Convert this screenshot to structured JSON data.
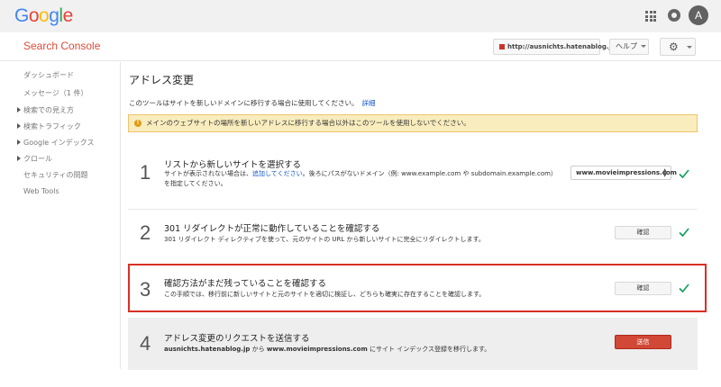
{
  "header": {
    "logo": "Google",
    "avatar_letter": "A"
  },
  "subbar": {
    "product": "Search Console",
    "site": "http://ausnichts.hatenablog.jp/",
    "help": "ヘルプ"
  },
  "sidebar": {
    "items": [
      {
        "label": "ダッシュボード",
        "expandable": false
      },
      {
        "label": "メッセージ（1 件）",
        "expandable": false
      },
      {
        "label": "検索での見え方",
        "expandable": true
      },
      {
        "label": "検索トラフィック",
        "expandable": true
      },
      {
        "label": "Google インデックス",
        "expandable": true
      },
      {
        "label": "クロール",
        "expandable": true
      },
      {
        "label": "セキュリティの問題",
        "expandable": false
      },
      {
        "label": "Web Tools",
        "expandable": false
      }
    ]
  },
  "main": {
    "title": "アドレス変更",
    "intro": "このツールはサイトを新しいドメインに移行する場合に使用してください。",
    "intro_link": "詳細",
    "warning": "メインのウェブサイトの場所を新しいアドレスに移行する場合以外はこのツールを使用しないでください。",
    "steps": [
      {
        "num": "1",
        "title": "リストから新しいサイトを選択する",
        "desc_a": "サイトが表示されない場合は、",
        "desc_link": "追加してください",
        "desc_b": "。後ろにパスがないドメイン（例: www.example.com や subdomain.example.com）",
        "desc_line2": "を指定してください。",
        "select_value": "www.movieimpressions.com"
      },
      {
        "num": "2",
        "title": "301 リダイレクトが正常に動作していることを確認する",
        "desc": "301 リダイレクト ディレクティブを使って、元のサイトの URL から新しいサイトに完全にリダイレクトします。",
        "button": "確認"
      },
      {
        "num": "3",
        "title": "確認方法がまだ残っていることを確認する",
        "desc": "この手順では、移行前に新しいサイトと元のサイトを適切に検証し、どちらも確実に存在することを確認します。",
        "button": "確認"
      },
      {
        "num": "4",
        "title": "アドレス変更のリクエストを送信する",
        "old_site": "ausnichts.hatenablog.jp",
        "desc_mid": " から ",
        "new_site": "www.movieimpressions.com",
        "desc_end": " にサイト インデックス登録を移行します。",
        "button": "送信"
      }
    ]
  },
  "colors": {
    "product_red": "#dd4b39",
    "check_green": "#0f9d58",
    "send_red": "#d14836",
    "highlight_red": "#d93025",
    "warning_bg": "#f9edbe"
  },
  "icons": [
    "apps-icon",
    "notifications-icon",
    "gear-icon",
    "warning-icon",
    "check-icon"
  ]
}
